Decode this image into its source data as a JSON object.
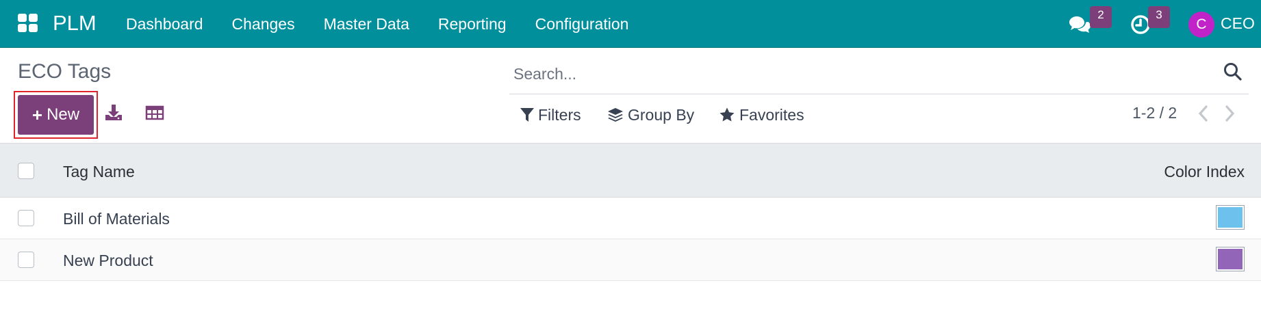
{
  "navbar": {
    "brand": "PLM",
    "menu": [
      "Dashboard",
      "Changes",
      "Master Data",
      "Reporting",
      "Configuration"
    ],
    "messages_badge": "2",
    "activities_badge": "3",
    "avatar_initial": "C",
    "user_name": "CEO",
    "bg_color": "#008f9b",
    "avatar_color": "#c223c9"
  },
  "control_panel": {
    "title": "ECO Tags",
    "new_label": "New",
    "search_placeholder": "Search...",
    "filters_label": "Filters",
    "group_by_label": "Group By",
    "favorites_label": "Favorites",
    "pager": "1-2 / 2",
    "primary_color": "#7b3f7a"
  },
  "table": {
    "columns": [
      "Tag Name",
      "Color Index"
    ],
    "rows": [
      {
        "name": "Bill of Materials",
        "color": "#6cc1ed"
      },
      {
        "name": "New Product",
        "color": "#9365b8"
      }
    ]
  }
}
